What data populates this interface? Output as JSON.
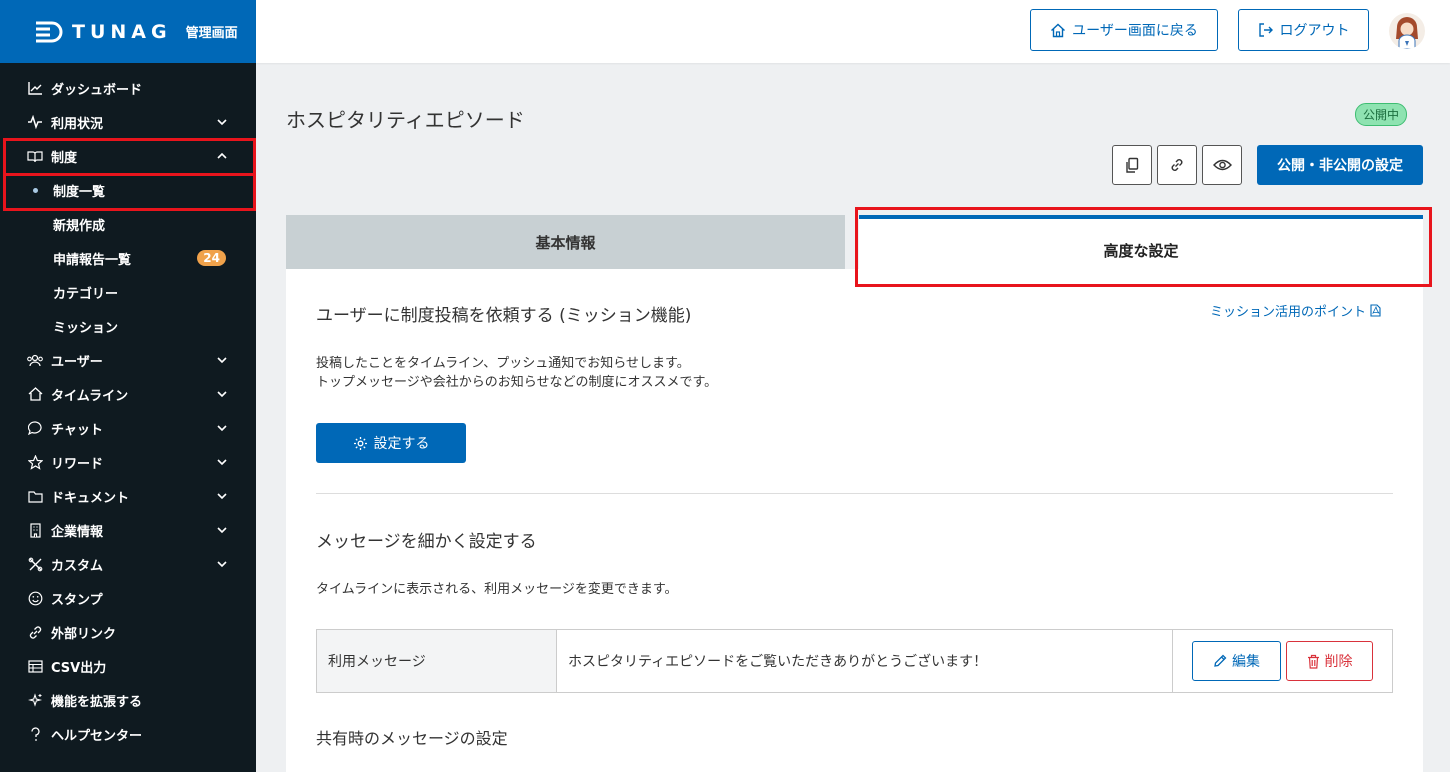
{
  "brand": {
    "logo": "TUNAG",
    "admin_label": "管理画面",
    "color": "#0068b7"
  },
  "sidebar": {
    "items": [
      {
        "label": "ダッシュボード",
        "icon": "chart-icon"
      },
      {
        "label": "利用状況",
        "icon": "pulse-icon"
      },
      {
        "label": "制度",
        "icon": "book-icon"
      },
      {
        "label": "ユーザー",
        "icon": "users-icon"
      },
      {
        "label": "タイムライン",
        "icon": "home-icon"
      },
      {
        "label": "チャット",
        "icon": "chat-icon"
      },
      {
        "label": "リワード",
        "icon": "star-icon"
      },
      {
        "label": "ドキュメント",
        "icon": "folder-icon"
      },
      {
        "label": "企業情報",
        "icon": "building-icon"
      },
      {
        "label": "カスタム",
        "icon": "tools-icon"
      },
      {
        "label": "スタンプ",
        "icon": "smile-icon"
      },
      {
        "label": "外部リンク",
        "icon": "link-icon"
      },
      {
        "label": "CSV出力",
        "icon": "table-icon"
      },
      {
        "label": "機能を拡張する",
        "icon": "sparkle-icon"
      },
      {
        "label": "ヘルプセンター",
        "icon": "help-icon"
      }
    ],
    "sub_items": [
      {
        "label": "制度一覧"
      },
      {
        "label": "新規作成"
      },
      {
        "label": "申請報告一覧",
        "badge": "24"
      },
      {
        "label": "カテゴリー"
      },
      {
        "label": "ミッション"
      }
    ]
  },
  "header": {
    "user_screen_button": "ユーザー画面に戻る",
    "logout_button": "ログアウト"
  },
  "main": {
    "title": "ホスピタリティエピソード",
    "status": "公開中",
    "publish_button": "公開・非公開の設定",
    "tabs": [
      {
        "label": "基本情報"
      },
      {
        "label": "高度な設定"
      }
    ],
    "mission": {
      "title": "ユーザーに制度投稿を依頼する (ミッション機能)",
      "link": "ミッション活用のポイント",
      "desc1": "投稿したことをタイムライン、プッシュ通知でお知らせします。",
      "desc2": "トップメッセージや会社からのお知らせなどの制度にオススメです。",
      "button": "設定する"
    },
    "message": {
      "title": "メッセージを細かく設定する",
      "desc": "タイムラインに表示される、利用メッセージを変更できます。",
      "row_label": "利用メッセージ",
      "row_value": "ホスピタリティエピソードをご覧いただきありがとうございます！",
      "edit": "編集",
      "delete": "削除"
    },
    "share_title": "共有時のメッセージの設定"
  }
}
